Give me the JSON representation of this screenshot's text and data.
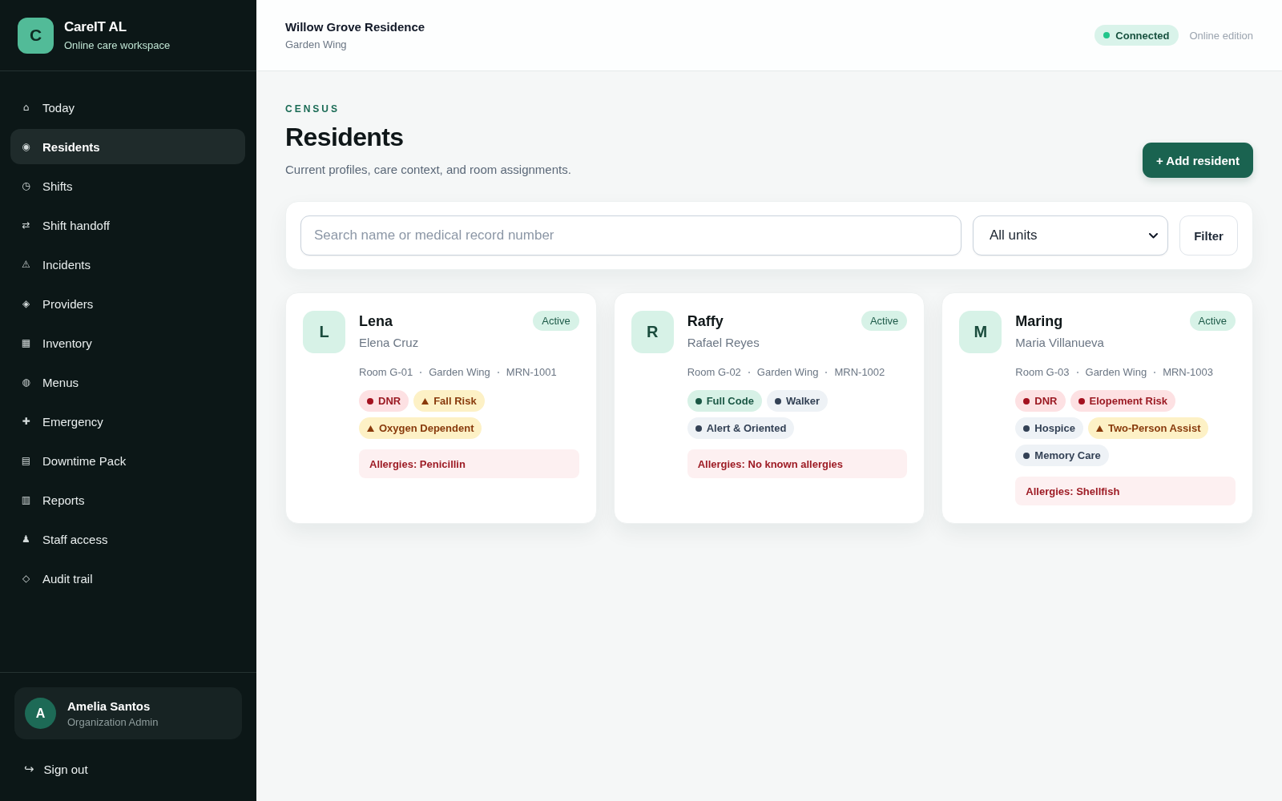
{
  "sidebar": {
    "brand": {
      "initial": "C",
      "name": "CareIT AL",
      "tagline": "Online care workspace"
    },
    "nav": [
      {
        "icon": "⌂",
        "label": "Today",
        "selected": false
      },
      {
        "icon": "◉",
        "label": "Residents",
        "selected": true
      },
      {
        "icon": "◷",
        "label": "Shifts",
        "selected": false
      },
      {
        "icon": "⇄",
        "label": "Shift handoff",
        "selected": false
      },
      {
        "icon": "⚠",
        "label": "Incidents",
        "selected": false
      },
      {
        "icon": "◈",
        "label": "Providers",
        "selected": false
      },
      {
        "icon": "▦",
        "label": "Inventory",
        "selected": false
      },
      {
        "icon": "◍",
        "label": "Menus",
        "selected": false
      },
      {
        "icon": "✚",
        "label": "Emergency",
        "selected": false
      },
      {
        "icon": "▤",
        "label": "Downtime Pack",
        "selected": false
      },
      {
        "icon": "▥",
        "label": "Reports",
        "selected": false
      },
      {
        "icon": "♟",
        "label": "Staff access",
        "selected": false
      },
      {
        "icon": "◇",
        "label": "Audit trail",
        "selected": false
      }
    ],
    "user": {
      "initial": "A",
      "name": "Amelia Santos",
      "role": "Organization Admin"
    },
    "sign_out": {
      "icon": "↪",
      "label": "Sign out"
    }
  },
  "header": {
    "facility": "Willow Grove Residence",
    "unit": "Garden Wing",
    "status": {
      "label": "Connected",
      "on": true
    },
    "edition": "Online edition"
  },
  "page": {
    "eyebrow": "CENSUS",
    "title": "Residents",
    "subtitle": "Current profiles, care context, and room assignments.",
    "add_button": "+ Add resident"
  },
  "filters": {
    "search": {
      "placeholder": "Search name or medical record number"
    },
    "unit_select": {
      "value": "All units"
    },
    "filter_button": "Filter"
  },
  "residents": [
    {
      "initial": "L",
      "name": "Lena",
      "full_name": "Elena Cruz",
      "status": "Active",
      "meta": [
        "Room G-01",
        "Garden Wing",
        "MRN-1001"
      ],
      "tags": [
        {
          "kind": "critical",
          "label": "DNR"
        },
        {
          "kind": "warning",
          "label": "Fall Risk"
        },
        {
          "kind": "warning",
          "label": "Oxygen Dependent"
        }
      ],
      "allergies": "Allergies: Penicillin"
    },
    {
      "initial": "R",
      "name": "Raffy",
      "full_name": "Rafael Reyes",
      "status": "Active",
      "meta": [
        "Room G-02",
        "Garden Wing",
        "MRN-1002"
      ],
      "tags": [
        {
          "kind": "positive",
          "label": "Full Code"
        },
        {
          "kind": "neutral",
          "label": "Walker"
        },
        {
          "kind": "neutral",
          "label": "Alert & Oriented"
        }
      ],
      "allergies": "Allergies: No known allergies"
    },
    {
      "initial": "M",
      "name": "Maring",
      "full_name": "Maria Villanueva",
      "status": "Active",
      "meta": [
        "Room G-03",
        "Garden Wing",
        "MRN-1003"
      ],
      "tags": [
        {
          "kind": "critical",
          "label": "DNR"
        },
        {
          "kind": "critical",
          "label": "Elopement Risk"
        },
        {
          "kind": "neutral",
          "label": "Hospice"
        },
        {
          "kind": "warning",
          "label": "Two-Person Assist"
        },
        {
          "kind": "neutral",
          "label": "Memory Care"
        }
      ],
      "allergies": "Allergies: Shellfish"
    }
  ]
}
